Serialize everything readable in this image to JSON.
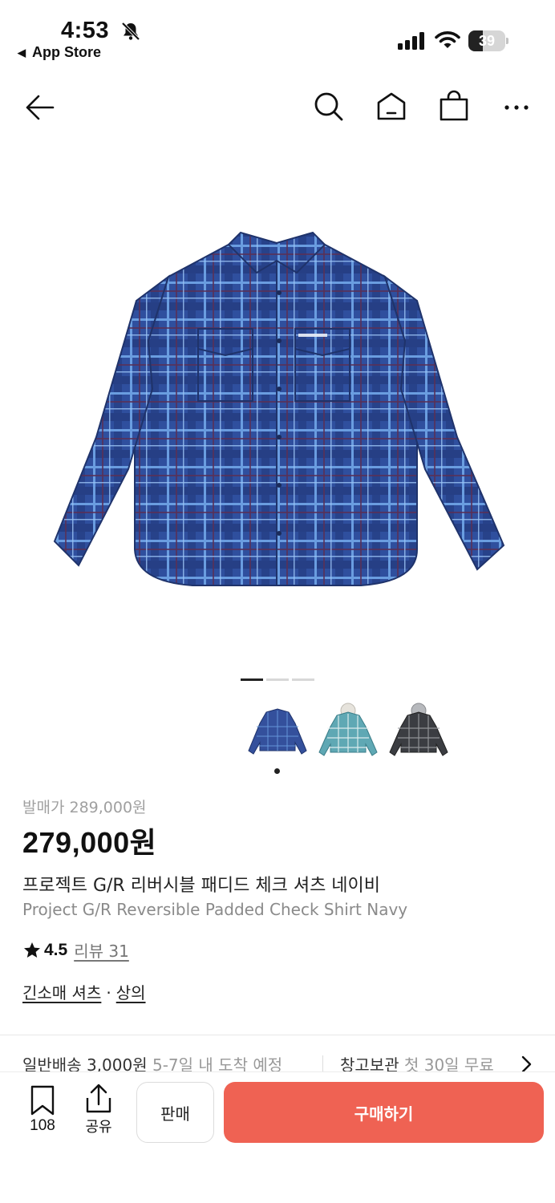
{
  "status_bar": {
    "time": "4:53",
    "back_app": "App Store",
    "battery": "39",
    "battery_level": 0.39
  },
  "nav": {
    "back_icon": "arrow-left-icon",
    "search_icon": "search-icon",
    "home_icon": "home-icon",
    "bag_icon": "shopping-bag-icon",
    "more_icon": "more-horizontal-icon"
  },
  "gallery": {
    "image_count": 3,
    "active_index": 0,
    "thumbnails": [
      {
        "name": "navy-check-shirt"
      },
      {
        "name": "teal-check-hooded-shirt"
      },
      {
        "name": "black-check-hooded-shirt"
      }
    ]
  },
  "product": {
    "release_price": "발매가 289,000원",
    "price": "279,000원",
    "name_ko": "프로젝트 G/R 리버시블 패디드 체크 셔츠 네이비",
    "name_en": "Project G/R Reversible Padded Check Shirt Navy",
    "rating": "4.5",
    "review": "리뷰 31",
    "category_1": "긴소매 셔츠",
    "category_sep": "·",
    "category_2": "상의"
  },
  "shipping": {
    "general_label": "일반배송 3,000원",
    "general_eta": "5-7일 내 도착 예정",
    "warehouse_label": "창고보관",
    "warehouse_detail": "첫 30일 무료"
  },
  "bottom_bar": {
    "save_count": "108",
    "share_label": "공유",
    "sell_label": "판매",
    "buy_label": "구매하기"
  },
  "colors": {
    "buy_button": "#ef6253",
    "shirt_navy": "#2f4f9e"
  }
}
